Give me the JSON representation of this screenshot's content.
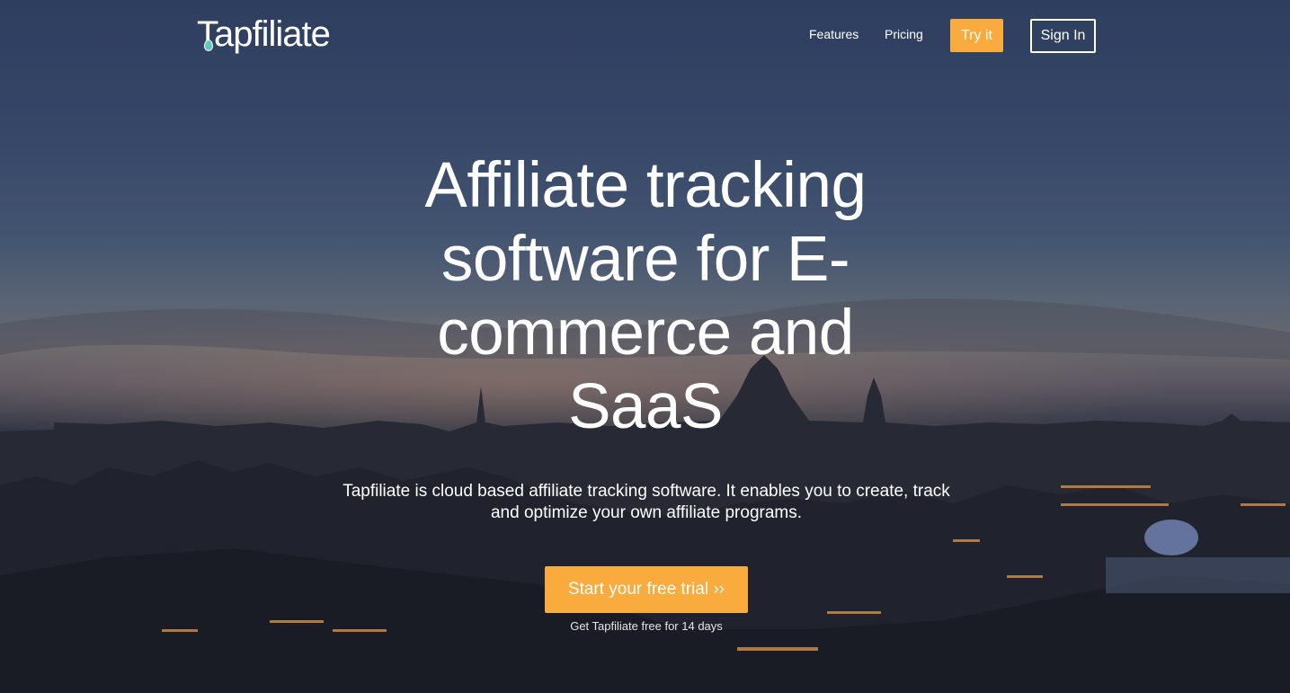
{
  "header": {
    "logo_text": "Tapfiliate",
    "nav": {
      "features": "Features",
      "pricing": "Pricing"
    },
    "try_label": "Try it",
    "signin_label": "Sign In"
  },
  "hero": {
    "title": "Affiliate tracking software for E-commerce and SaaS",
    "subtitle": "Tapfiliate is cloud based affiliate tracking software. It enables you to create, track and optimize your own affiliate programs.",
    "cta_label": "Start your free trial ››",
    "cta_note": "Get Tapfiliate free for 14 days"
  },
  "colors": {
    "accent": "#f9ab3d",
    "text": "#ffffff",
    "logo_drop": "#5fc6c0"
  }
}
